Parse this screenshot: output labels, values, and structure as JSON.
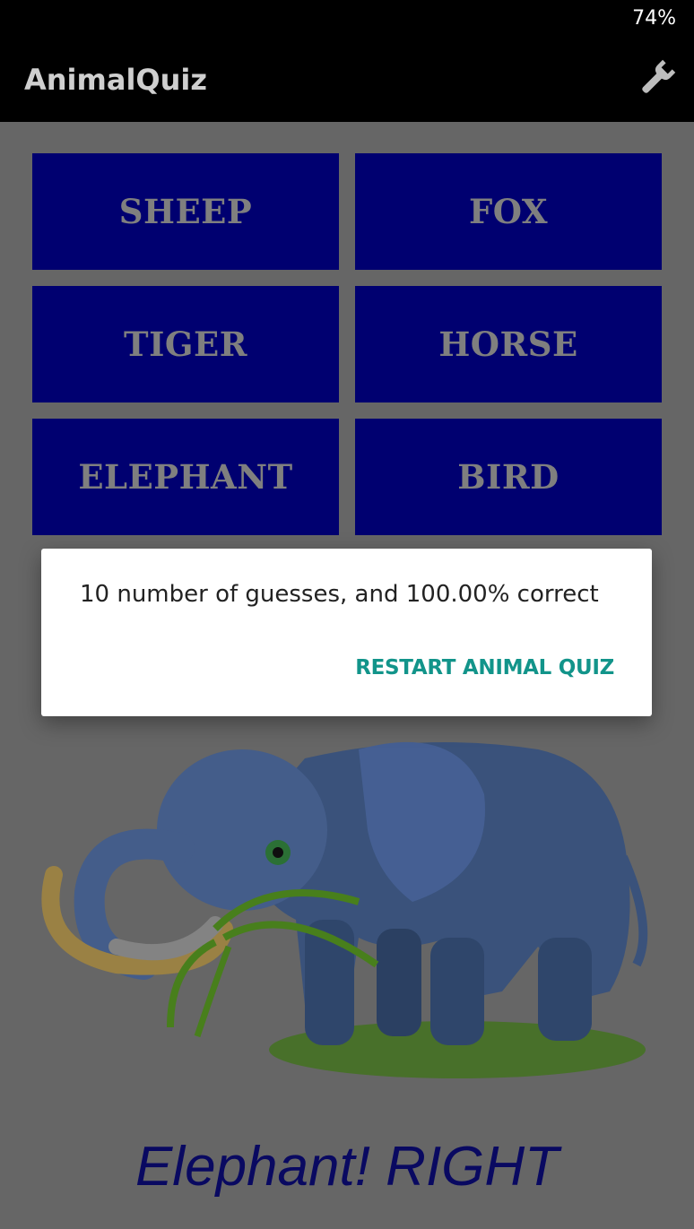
{
  "status_bar": {
    "battery": "74%"
  },
  "app_bar": {
    "title": "AnimalQuiz",
    "settings_icon": "wrench-icon"
  },
  "answers": [
    "SHEEP",
    "FOX",
    "TIGER",
    "HORSE",
    "ELEPHANT",
    "BIRD"
  ],
  "dialog": {
    "message": "10 number of guesses, and 100.00% correct",
    "action_label": "RESTART ANIMAL QUIZ"
  },
  "result_text": "Elephant! RIGHT",
  "colors": {
    "answer_button": "#00007a",
    "dialog_action": "#12948a",
    "result_text": "#0a0a6a"
  }
}
